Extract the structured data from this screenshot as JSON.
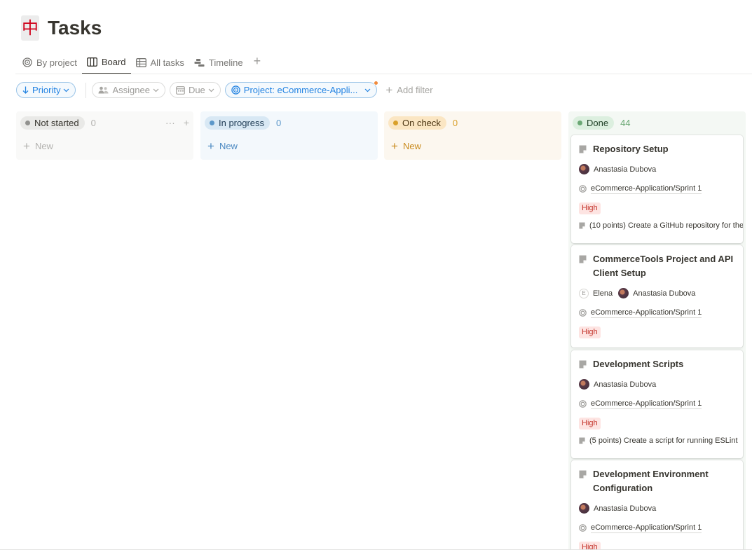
{
  "page": {
    "icon_char": "中",
    "title": "Tasks"
  },
  "tabs": [
    {
      "label": "By project",
      "icon": "target-icon"
    },
    {
      "label": "Board",
      "icon": "board-icon",
      "active": true
    },
    {
      "label": "All tasks",
      "icon": "table-icon"
    },
    {
      "label": "Timeline",
      "icon": "timeline-icon"
    }
  ],
  "tabs_add": "+",
  "filters": {
    "priority": "Priority",
    "assignee": "Assignee",
    "due": "Due",
    "project": "Project: eCommerce-Appli...",
    "add_filter": "Add filter"
  },
  "columns": {
    "not_started": {
      "label": "Not started",
      "count": "0",
      "new": "New",
      "color": "#9b9a97"
    },
    "in_progress": {
      "label": "In progress",
      "count": "0",
      "new": "New",
      "color": "#5b97c9"
    },
    "on_check": {
      "label": "On check",
      "count": "0",
      "new": "New",
      "color": "#d9a02a"
    },
    "done": {
      "label": "Done",
      "count": "44",
      "color": "#6aa774"
    }
  },
  "cards": [
    {
      "title": "Repository Setup",
      "assignees": [
        "Anastasia Dubova"
      ],
      "project": "eCommerce-Application/Sprint 1",
      "priority": "High",
      "subtask": "(10 points) Create a GitHub repository for the"
    },
    {
      "title": "CommerceTools Project and API Client Setup",
      "assignee_initial": "E",
      "assignees": [
        "Elena",
        "Anastasia Dubova"
      ],
      "project": "eCommerce-Application/Sprint 1",
      "priority": "High"
    },
    {
      "title": "Development Scripts",
      "assignees": [
        "Anastasia Dubova"
      ],
      "project": "eCommerce-Application/Sprint 1",
      "priority": "High",
      "subtask": "(5 points) Create a script for running ESLint"
    },
    {
      "title": "Development Environment Configuration",
      "assignees": [
        "Anastasia Dubova"
      ],
      "project": "eCommerce-Application/Sprint 1",
      "priority": "High"
    }
  ]
}
